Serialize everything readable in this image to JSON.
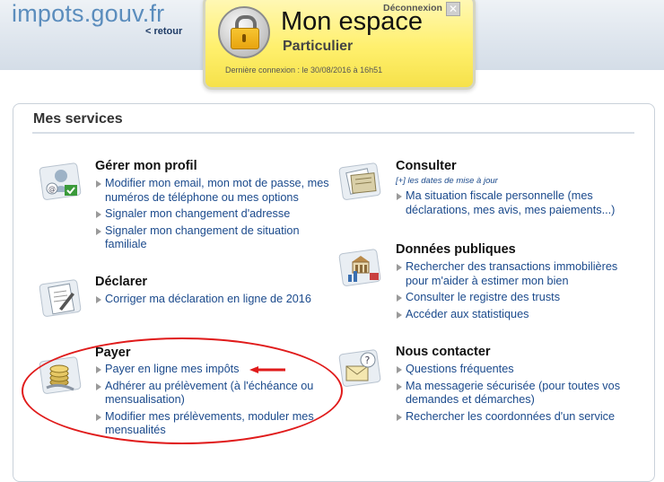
{
  "header": {
    "logo_text": "impots.gouv.fr",
    "retour_link": "< retour",
    "espace_title": "Mon espace",
    "espace_subtitle": "Particulier",
    "deconnexion": "Déconnexion",
    "close_glyph": "✕",
    "last_connection": "Dernière connexion : le 30/08/2016 à 16h51"
  },
  "panel": {
    "title": "Mes services"
  },
  "services": {
    "profil": {
      "icon": "profile-icon",
      "title": "Gérer mon profil",
      "links": [
        "Modifier mon email, mon mot de passe, mes numéros de téléphone ou mes options",
        "Signaler mon changement d'adresse",
        "Signaler mon changement de situation familiale"
      ]
    },
    "declarer": {
      "icon": "declaration-icon",
      "title": "Déclarer",
      "links": [
        "Corriger ma déclaration en ligne de 2016"
      ]
    },
    "payer": {
      "icon": "coins-icon",
      "title": "Payer",
      "links": [
        "Payer en ligne mes impôts",
        "Adhérer au prélèvement (à l'échéance ou mensualisation)",
        "Modifier mes prélèvements, moduler mes mensualités"
      ]
    },
    "consulter": {
      "icon": "folder-icon",
      "title": "Consulter",
      "subtitle": "[+] les dates de mise à jour",
      "links": [
        "Ma situation fiscale personnelle (mes déclarations, mes avis, mes paiements...)"
      ]
    },
    "donnees": {
      "icon": "public-data-icon",
      "title": "Données publiques",
      "links": [
        "Rechercher des transactions immobilières pour m'aider à estimer mon bien",
        "Consulter le registre des trusts",
        "Accéder aux statistiques"
      ]
    },
    "contact": {
      "icon": "contact-mail-icon",
      "title": "Nous contacter",
      "links": [
        "Questions fréquentes",
        "Ma messagerie sécurisée (pour toutes vos demandes et démarches)",
        "Rechercher les coordonnées d'un service"
      ]
    }
  },
  "colors": {
    "link": "#1b4a8c",
    "highlight_red": "#e01b1b",
    "espace_yellow": "#fff06e"
  }
}
